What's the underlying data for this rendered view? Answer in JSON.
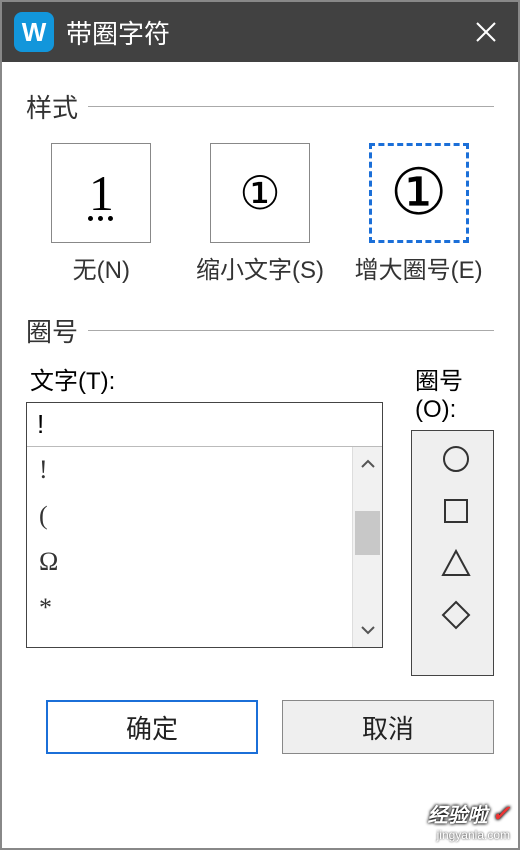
{
  "titlebar": {
    "app_icon_letter": "W",
    "title": "带圈字符"
  },
  "style_section": {
    "legend": "样式",
    "options": [
      {
        "glyph": "1",
        "label": "无(N)",
        "selected": false
      },
      {
        "glyph": "①",
        "label": "缩小文字(S)",
        "selected": false
      },
      {
        "glyph": "①",
        "label": "增大圈号(E)",
        "selected": true
      }
    ]
  },
  "enclose_section": {
    "legend": "圈号",
    "text_label": "文字(T):",
    "shape_label": "圈号(O):",
    "text_value": "!",
    "text_options": [
      "!",
      "(",
      "Ω",
      "*"
    ],
    "shapes": [
      "circle",
      "square",
      "triangle",
      "diamond"
    ]
  },
  "buttons": {
    "ok": "确定",
    "cancel": "取消"
  },
  "watermark": {
    "main": "经验啦",
    "sub": "jingyanla.com"
  }
}
